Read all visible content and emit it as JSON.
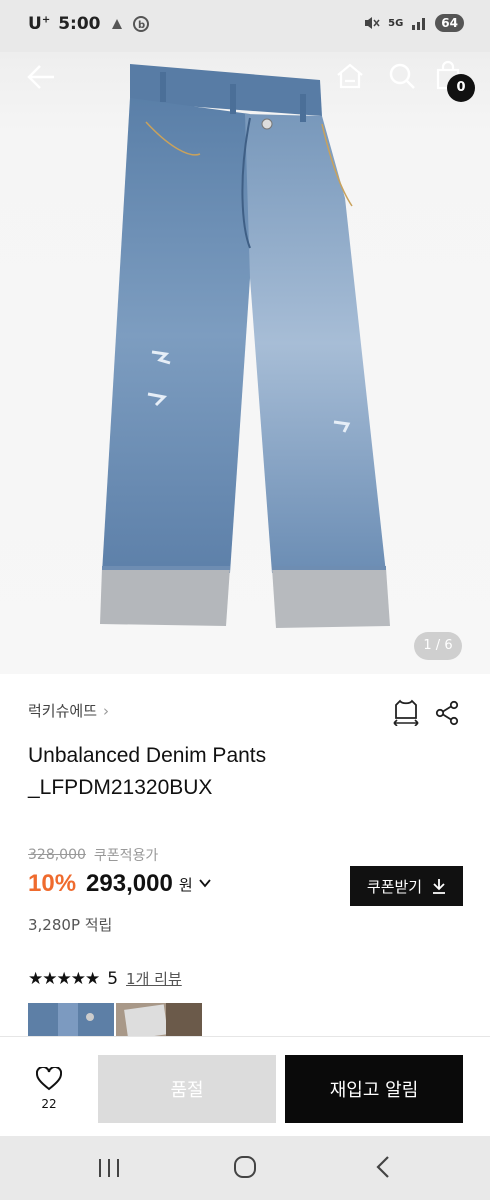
{
  "status_bar": {
    "carrier": "U",
    "carrier_sup": "+",
    "time": "5:00",
    "network": "5G",
    "battery": "64"
  },
  "hero": {
    "page_indicator": "1 / 6",
    "cart_count": "0"
  },
  "product": {
    "brand": "럭키슈에뜨",
    "name_line1": "Unbalanced Denim Pants",
    "name_line2": "_LFPDM21320BUX",
    "original_price": "328,000",
    "coupon_applicable": "쿠폰적용가",
    "discount": "10%",
    "sale_price": "293,000",
    "currency": "원",
    "coupon_button": "쿠폰받기",
    "points": "3,280P 적립",
    "rating_stars": "★★★★★",
    "rating": "5",
    "review_link": "1개 리뷰"
  },
  "action_bar": {
    "like_count": "22",
    "soldout_label": "품절",
    "restock_label": "재입고 알림"
  },
  "icons": {
    "back": "arrow-left-icon",
    "home": "home-icon",
    "search": "search-icon",
    "cart": "shopping-bag-icon",
    "fit": "size-guide-icon",
    "share": "share-icon",
    "heart": "heart-icon",
    "download": "download-icon"
  },
  "colors": {
    "discount": "#ef6b2e",
    "primary": "#0a0a0a",
    "disabled": "#dcdcdc"
  }
}
